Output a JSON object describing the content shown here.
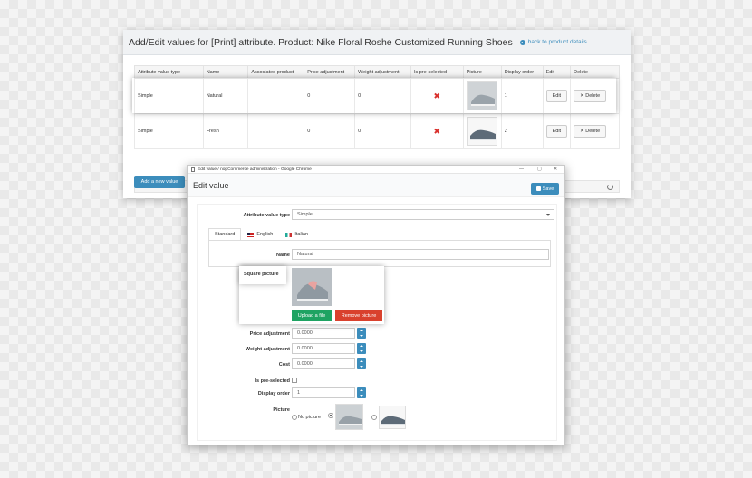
{
  "back_panel": {
    "title": "Add/Edit values for [Print] attribute. Product: Nike Floral Roshe Customized Running Shoes",
    "back_link": "back to product details",
    "columns": [
      "Attribute value type",
      "Name",
      "Associated product",
      "Price adjustment",
      "Weight adjustment",
      "Is pre-selected",
      "Picture",
      "Display order",
      "Edit",
      "Delete"
    ],
    "rows": [
      {
        "type": "Simple",
        "name": "Natural",
        "associated": "",
        "price": "0",
        "weight": "0",
        "display_order": "1",
        "edit": "Edit",
        "delete": "Delete"
      },
      {
        "type": "Simple",
        "name": "Fresh",
        "associated": "",
        "price": "0",
        "weight": "0",
        "display_order": "2",
        "edit": "Edit",
        "delete": "Delete"
      }
    ],
    "add_button": "Add a new value"
  },
  "popup": {
    "window_title": "Edit value / nopCommerce administration - Google Chrome",
    "page_title": "Edit value",
    "save_label": "Save",
    "attr_type_label": "Attribute value type",
    "attr_type_value": "Simple",
    "tabs": [
      "Standard",
      "English",
      "Italian"
    ],
    "name_label": "Name",
    "name_value": "Natural",
    "square_picture_label": "Square picture",
    "upload_label": "Upload a file",
    "remove_label": "Remove picture",
    "price_label": "Price adjustment",
    "price_value": "0.0000",
    "weight_label": "Weight adjustment",
    "weight_value": "0.0000",
    "cost_label": "Cost",
    "cost_value": "0.0000",
    "preselected_label": "Is pre-selected",
    "display_order_label": "Display order",
    "display_order_value": "1",
    "picture_label": "Picture",
    "no_picture_label": "No picture"
  },
  "colors": {
    "accent": "#3c8dbc",
    "upload": "#1ea362",
    "remove": "#d9412d",
    "cross": "#d9302c"
  }
}
